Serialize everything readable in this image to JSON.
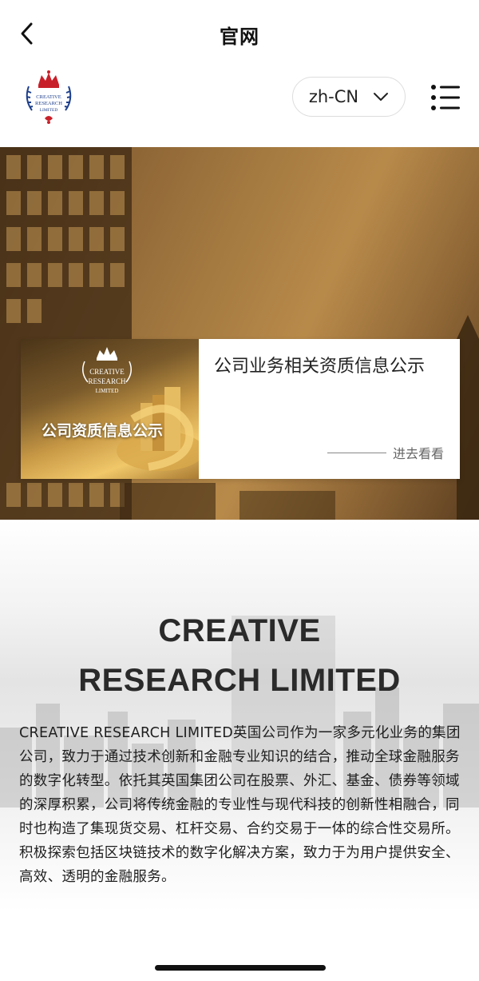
{
  "navbar": {
    "title": "官网",
    "back_icon": "chevron-left-icon"
  },
  "header": {
    "logo": {
      "line1": "CREATIVE",
      "line2": "RESEARCH",
      "line3": "LIMITED",
      "colors": {
        "crown": "#c8202a",
        "wreath": "#1d3f8c",
        "text": "#1d3f8c"
      }
    },
    "language": {
      "value": "zh-CN",
      "icon": "chevron-down-icon"
    },
    "menu_icon": "list-menu-icon"
  },
  "banner": {
    "card": {
      "image_caption": "公司资质信息公示",
      "image_logo": {
        "line1": "CREATIVE",
        "line2": "RESEARCH",
        "line3": "LIMITED"
      },
      "title": "公司业务相关资质信息公示",
      "link_label": "进去看看"
    }
  },
  "intro": {
    "heading_line1": "CREATIVE",
    "heading_line2": "RESEARCH LIMITED",
    "body": "CREATIVE RESEARCH LIMITED英国公司作为一家多元化业务的集团公司，致力于通过技术创新和金融专业知识的结合，推动全球金融服务的数字化转型。依托其英国集团公司在股票、外汇、基金、债券等领域的深厚积累，公司将传统金融的专业性与现代科技的创新性相融合，同时也构造了集现货交易、杠杆交易、合约交易于一体的综合性交易所。积极探索包括区块链技术的数字化解决方案，致力于为用户提供安全、高效、透明的金融服务。"
  }
}
